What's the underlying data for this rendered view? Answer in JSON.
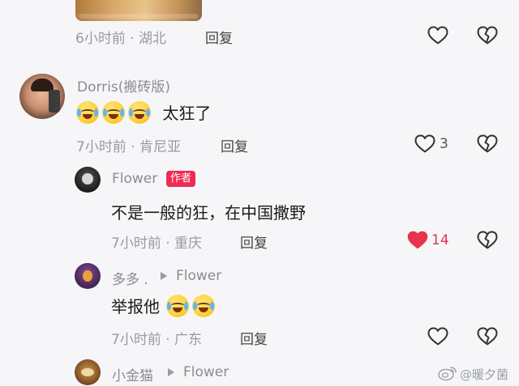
{
  "comments": [
    {
      "time_location": "6小时前 · 湖北",
      "reply_label": "回复"
    },
    {
      "username": "Dorris(搬砖版)",
      "text": "太狂了",
      "emoji": [
        "crying-laughing",
        "crying-laughing",
        "crying-laughing"
      ],
      "time_location": "7小时前 · 肯尼亚",
      "reply_label": "回复",
      "like_count": "3"
    },
    {
      "username": "Flower",
      "badge": "作者",
      "text": "不是一般的狂，在中国撒野",
      "time_location": "7小时前 · 重庆",
      "reply_label": "回复",
      "like_count": "14",
      "liked": true
    },
    {
      "username": "多多 .",
      "reply_to": "Flower",
      "text": "举报他",
      "emoji": [
        "crying-laughing",
        "crying-laughing"
      ],
      "time_location": "7小时前 · 广东",
      "reply_label": "回复"
    },
    {
      "username": "小金猫",
      "reply_to": "Flower"
    }
  ],
  "watermark": "@暖夕菌",
  "colors": {
    "background": "#f6f6f8",
    "like_active": "#e8324e",
    "author_badge": "#ee2c53"
  },
  "icons": [
    "heart-outline-icon",
    "heart-filled-icon",
    "broken-heart-icon",
    "weibo-logo-icon",
    "reply-arrow-icon"
  ]
}
